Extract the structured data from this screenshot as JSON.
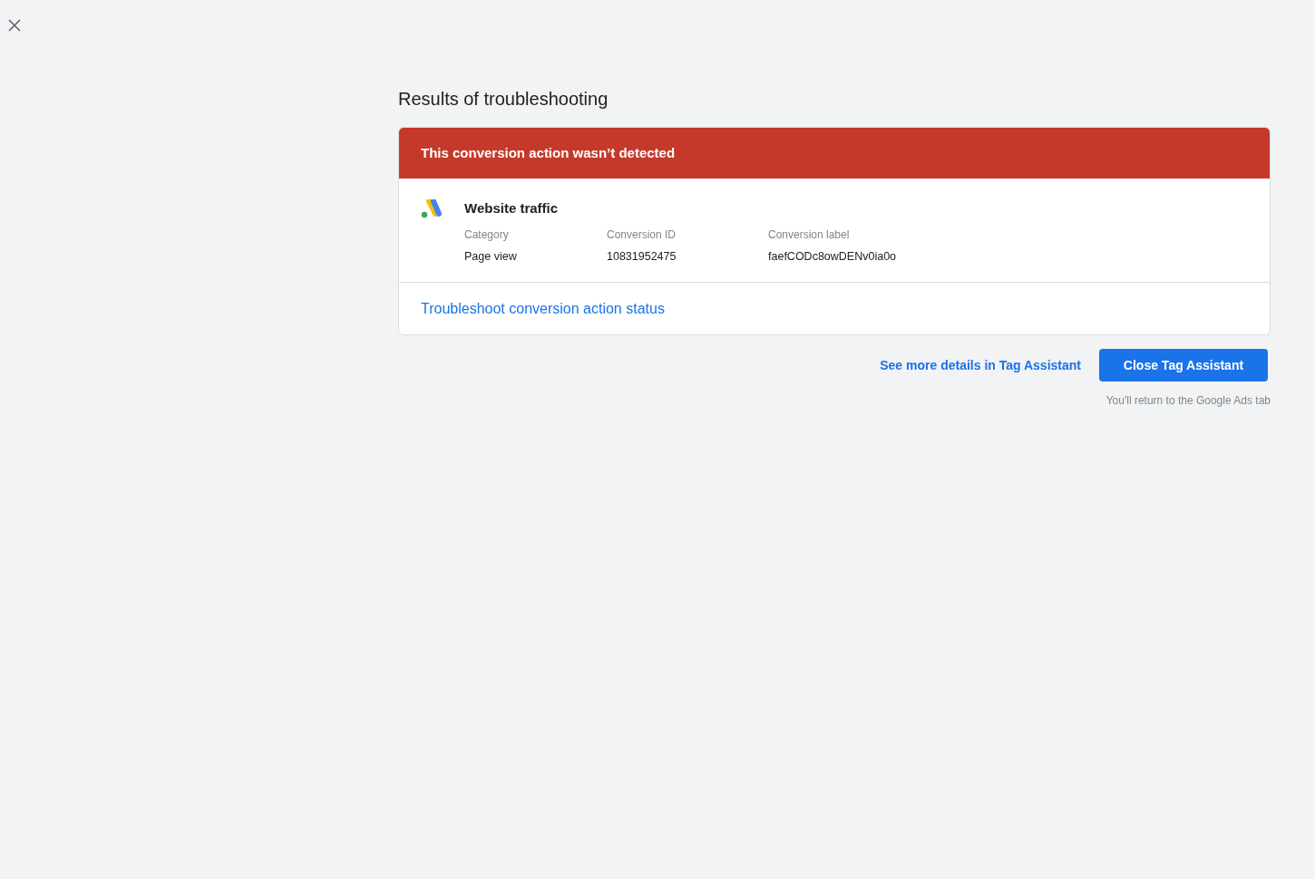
{
  "title": "Results of troubleshooting",
  "card": {
    "banner": "This conversion action wasn’t detected",
    "action_name": "Website traffic",
    "fields": [
      {
        "label": "Category",
        "value": "Page view"
      },
      {
        "label": "Conversion ID",
        "value": "10831952475"
      },
      {
        "label": "Conversion label",
        "value": "faefCODc8owDENv0ia0o"
      }
    ],
    "link": "Troubleshoot conversion action status"
  },
  "secondary_link": "See more details in Tag Assistant",
  "primary_button": "Close Tag Assistant",
  "note": "You'll return to the Google Ads tab"
}
